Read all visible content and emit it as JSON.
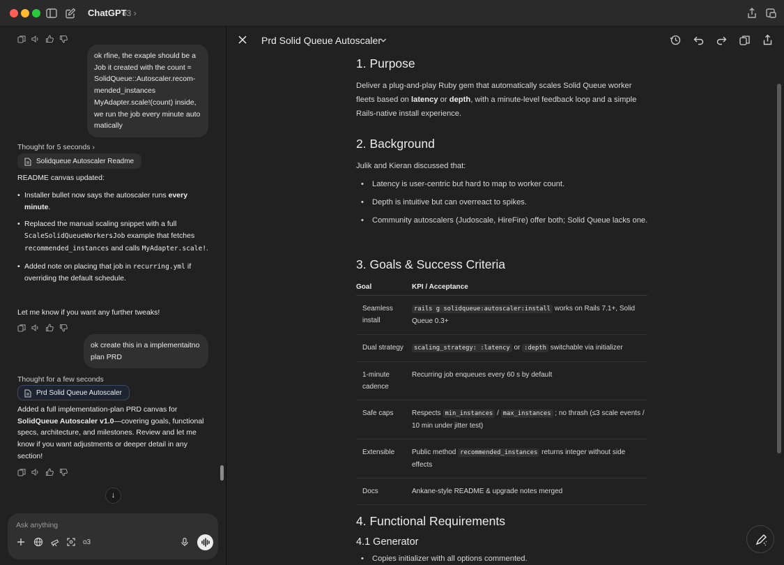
{
  "app": {
    "title": "ChatGPT",
    "model": "o3"
  },
  "chat": {
    "messages": [
      {
        "role": "user",
        "lines": [
          "ok rfine, the exaple should be a",
          "Job it created with the count =",
          "SolidQueue::Autoscaler.recom-",
          "mended_instances",
          "MyAdapter.scale!(count) inside,",
          "we run the job every minute auto",
          "matically"
        ]
      },
      {
        "role": "assistant",
        "thought": "Thought for 5 seconds",
        "chip": "Solidqueue Autoscaler Readme",
        "intro": "README canvas updated:",
        "bullets": [
          {
            "pre": "Installer bullet now says the autoscaler runs ",
            "bold": "every minute",
            "post": "."
          },
          {
            "pre": "Replaced the manual scaling snippet with a full ",
            "code1": "ScaleSolidQueueWorkersJob",
            "mid": " example that fetches ",
            "code2": "recommended_instances",
            "mid2": " and calls ",
            "code3": "MyAdapter.scale!",
            "post": "."
          },
          {
            "pre": "Added note on placing that job in ",
            "code1": "recurring.yml",
            "post": " if overriding the default schedule."
          }
        ],
        "outro": "Let me know if you want any further tweaks!"
      },
      {
        "role": "user",
        "lines": [
          "ok create this in a implementaitno",
          "plan PRD"
        ]
      },
      {
        "role": "assistant",
        "thought": "Thought for a few seconds",
        "chip": "Prd Solid Queue Autoscaler",
        "text_pre": "Added a full implementation-plan PRD canvas for ",
        "text_bold": "SolidQueue Autoscaler v1.0",
        "text_post": "—covering goals, functional specs, architecture, and milestones. Review and let me know if you want adjustments or deeper detail in any section!"
      }
    ],
    "composer": {
      "placeholder": "Ask anything",
      "model": "o3"
    }
  },
  "canvas": {
    "title": "Prd Solid Queue Autoscaler",
    "sections": {
      "purpose": {
        "heading": "1. Purpose",
        "text_pre": "Deliver a plug-and-play Ruby gem that automatically scales Solid Queue worker fleets based on ",
        "bold1": "latency",
        "mid": " or ",
        "bold2": "depth",
        "text_post": ", with a minute-level feedback loop and a simple Rails-native install experience."
      },
      "background": {
        "heading": "2. Background",
        "intro": "Julik and Kieran discussed that:",
        "bullets": [
          "Latency is user-centric but hard to map to worker count.",
          "Depth is intuitive but can overreact to spikes.",
          "Community autoscalers (Judoscale, HireFire) offer both; Solid Queue lacks one."
        ]
      },
      "goals": {
        "heading": "3. Goals & Success Criteria",
        "columns": [
          "Goal",
          "KPI / Acceptance"
        ],
        "rows": [
          {
            "goal": "Seamless install",
            "c1": "rails g solidqueue:autoscaler:install",
            "t1": " works on Rails 7.1+, Solid Queue 0.3+"
          },
          {
            "goal": "Dual strategy",
            "c1": "scaling_strategy: :latency",
            "t1": " or ",
            "c2": ":depth",
            "t2": " switchable via initializer"
          },
          {
            "goal": "1-minute cadence",
            "t0": "Recurring job enqueues every 60 s by default"
          },
          {
            "goal": "Safe caps",
            "t0": "Respects ",
            "c1": "min_instances",
            "t1": " / ",
            "c2": "max_instances",
            "t2": " ; no thrash (≤3 scale events / 10 min under jitter test)"
          },
          {
            "goal": "Extensible",
            "t0": "Public method ",
            "c1": "recommended_instances",
            "t1": " returns integer without side effects"
          },
          {
            "goal": "Docs",
            "t0": "Ankane-style README & upgrade notes merged"
          }
        ]
      },
      "functional": {
        "heading": "4. Functional Requirements",
        "sub": "4.1 Generator",
        "bullets": [
          "Copies initializer with all options commented."
        ]
      }
    }
  }
}
